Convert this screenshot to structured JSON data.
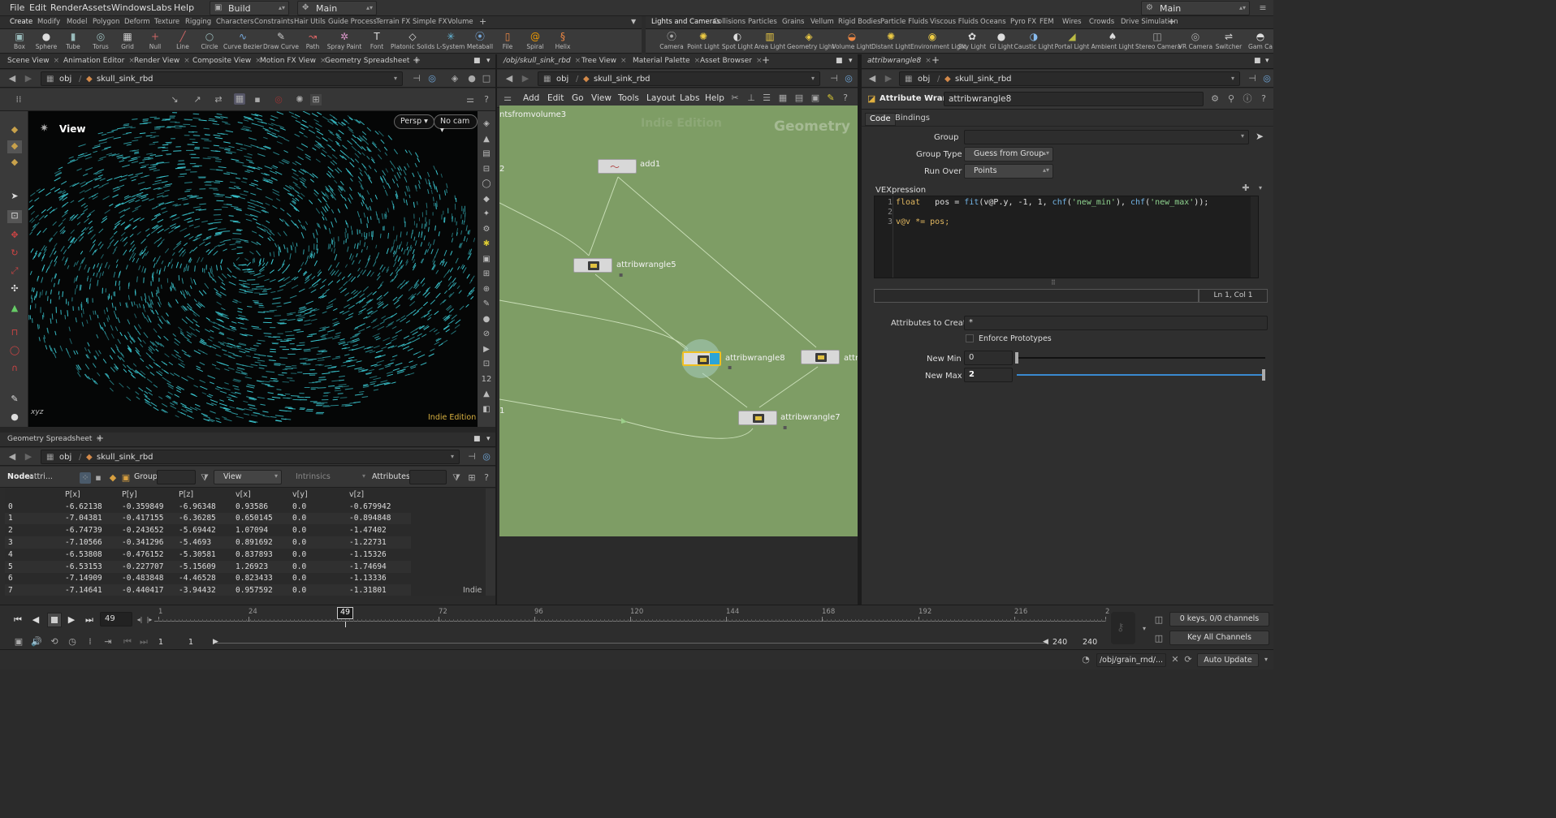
{
  "menubar": {
    "items": [
      "File",
      "Edit",
      "Render",
      "Assets",
      "Windows",
      "Labs",
      "Help"
    ],
    "desktop": "Build",
    "context": "Main",
    "right_desktop": "Main"
  },
  "shelf_tabs_left": [
    "Create",
    "Modify",
    "Model",
    "Polygon",
    "Deform",
    "Texture",
    "Rigging",
    "Characters",
    "Constraints",
    "Hair Utils",
    "Guide Process",
    "Terrain FX",
    "Simple FX",
    "Volume"
  ],
  "shelf_tabs_right": [
    "Lights and Cameras",
    "Collisions",
    "Particles",
    "Grains",
    "Vellum",
    "Rigid Bodies",
    "Particle Fluids",
    "Viscous Fluids",
    "Oceans",
    "Pyro FX",
    "FEM",
    "Wires",
    "Crowds",
    "Drive Simulation"
  ],
  "tools_left": [
    {
      "label": "Box",
      "icon": "cube-icon"
    },
    {
      "label": "Sphere",
      "icon": "sphere-icon"
    },
    {
      "label": "Tube",
      "icon": "tube-icon"
    },
    {
      "label": "Torus",
      "icon": "torus-icon"
    },
    {
      "label": "Grid",
      "icon": "grid-icon"
    },
    {
      "label": "Null",
      "icon": "null-icon"
    },
    {
      "label": "Line",
      "icon": "line-icon"
    },
    {
      "label": "Circle",
      "icon": "circle-icon"
    },
    {
      "label": "Curve Bezier",
      "icon": "curve-icon"
    },
    {
      "label": "Draw Curve",
      "icon": "draw-curve-icon"
    },
    {
      "label": "Path",
      "icon": "path-icon"
    },
    {
      "label": "Spray Paint",
      "icon": "spray-icon"
    },
    {
      "label": "Font",
      "icon": "font-icon"
    },
    {
      "label": "Platonic Solids",
      "icon": "platonic-icon"
    },
    {
      "label": "L-System",
      "icon": "lsystem-icon"
    },
    {
      "label": "Metaball",
      "icon": "metaball-icon"
    },
    {
      "label": "File",
      "icon": "file-icon"
    },
    {
      "label": "Spiral",
      "icon": "spiral-icon"
    },
    {
      "label": "Helix",
      "icon": "helix-icon"
    }
  ],
  "tools_right": [
    {
      "label": "Camera"
    },
    {
      "label": "Point Light"
    },
    {
      "label": "Spot Light"
    },
    {
      "label": "Area Light"
    },
    {
      "label": "Geometry Light"
    },
    {
      "label": "Volume Light"
    },
    {
      "label": "Distant Light"
    },
    {
      "label": "Environment Light"
    },
    {
      "label": "Sky Light"
    },
    {
      "label": "GI Light"
    },
    {
      "label": "Caustic Light"
    },
    {
      "label": "Portal Light"
    },
    {
      "label": "Ambient Light"
    },
    {
      "label": "Stereo Camera"
    },
    {
      "label": "VR Camera"
    },
    {
      "label": "Switcher"
    },
    {
      "label": "Gam Ca"
    }
  ],
  "left_pane": {
    "tabs": [
      "Scene View",
      "Animation Editor",
      "Render View",
      "Composite View",
      "Motion FX View",
      "Geometry Spreadsheet"
    ],
    "path_obj": "obj",
    "path_node": "skull_sink_rbd",
    "viewport": {
      "title": "View",
      "persp": "Persp",
      "cam": "No cam",
      "edition": "Indie Edition",
      "axes": "xyz"
    }
  },
  "spreadsheet": {
    "tab": "Geometry Spreadsheet",
    "path_obj": "obj",
    "path_node": "skull_sink_rbd",
    "node_label": "Node:",
    "node_value": "attri...",
    "group_label": "Group:",
    "view_label": "View",
    "intrinsics_label": "Intrinsics",
    "attributes_label": "Attributes:",
    "indie": "Indie",
    "columns": [
      "",
      "P[x]",
      "P[y]",
      "P[z]",
      "v[x]",
      "v[y]",
      "v[z]"
    ],
    "rows": [
      [
        "0",
        "-6.62138",
        "-0.359849",
        "-6.96348",
        "0.93586",
        "0.0",
        "-0.679942"
      ],
      [
        "1",
        "-7.04381",
        "-0.417155",
        "-6.36285",
        "0.650145",
        "0.0",
        "-0.894848"
      ],
      [
        "2",
        "-6.74739",
        "-0.243652",
        "-5.69442",
        "1.07094",
        "0.0",
        "-1.47402"
      ],
      [
        "3",
        "-7.10566",
        "-0.341296",
        "-5.4693",
        "0.891692",
        "0.0",
        "-1.22731"
      ],
      [
        "4",
        "-6.53808",
        "-0.476152",
        "-5.30581",
        "0.837893",
        "0.0",
        "-1.15326"
      ],
      [
        "5",
        "-6.53153",
        "-0.227707",
        "-5.15609",
        "1.26923",
        "0.0",
        "-1.74694"
      ],
      [
        "6",
        "-7.14909",
        "-0.483848",
        "-4.46528",
        "0.823433",
        "0.0",
        "-1.13336"
      ],
      [
        "7",
        "-7.14641",
        "-0.440417",
        "-3.94432",
        "0.957592",
        "0.0",
        "-1.31801"
      ]
    ]
  },
  "network": {
    "tabs": [
      "/obj/skull_sink_rbd",
      "Tree View",
      "Material Palette",
      "Asset Browser"
    ],
    "path_obj": "obj",
    "path_node": "skull_sink_rbd",
    "menu": [
      "Add",
      "Edit",
      "Go",
      "View",
      "Tools",
      "Layout",
      "Labs",
      "Help"
    ],
    "context_label": "Geometry",
    "watermark": "Indie Edition",
    "partial_left": "ntsfromvolume3",
    "edge_label_a": "2",
    "edge_label_b": "1",
    "nodes": [
      {
        "name": "add1"
      },
      {
        "name": "attribwrangle5"
      },
      {
        "name": "attribwrangle8"
      },
      {
        "name": "attr"
      },
      {
        "name": "attribwrangle7"
      }
    ]
  },
  "params": {
    "tab": "attribwrangle8",
    "path_obj": "obj",
    "path_node": "skull_sink_rbd",
    "node_type": "Attribute Wrangle",
    "node_name": "attribwrangle8",
    "subtabs": [
      "Code",
      "Bindings"
    ],
    "group_label": "Group",
    "group_value": "",
    "group_type_label": "Group Type",
    "group_type_value": "Guess from Group",
    "run_over_label": "Run Over",
    "run_over_value": "Points",
    "vex_label": "VEXpression",
    "code_lines": [
      {
        "num": "1"
      },
      {
        "num": "2"
      },
      {
        "num": "3"
      }
    ],
    "code_text": {
      "l1_kw": "float",
      "l1_a": "   pos = ",
      "l1_fn1": "fit",
      "l1_b": "(v@P.y, -1, 1, ",
      "l1_fn2": "chf",
      "l1_c": "(",
      "l1_s1": "'new_min'",
      "l1_d": "), ",
      "l1_fn3": "chf",
      "l1_e": "(",
      "l1_s2": "'new_max'",
      "l1_f": "));",
      "l3": "v@v *= pos;"
    },
    "cursor": "Ln 1, Col 1",
    "attributes_label": "Attributes to Create",
    "attributes_value": "*",
    "enforce_label": "Enforce Prototypes",
    "new_min_label": "New Min",
    "new_min_value": "0",
    "new_max_label": "New Max",
    "new_max_value": "2",
    "slider_range": [
      0,
      2
    ]
  },
  "timeline": {
    "current_frame": "49",
    "marker": "49",
    "ticks": [
      "1",
      "24",
      "48",
      "72",
      "96",
      "120",
      "144",
      "168",
      "192",
      "216",
      "2"
    ],
    "range_start": "1",
    "range_start2": "1",
    "range_end": "240",
    "range_end2": "240",
    "keys": "0 keys, 0/0 channels",
    "key_all": "Key All Channels"
  },
  "status": {
    "path": "/obj/grain_rnd/...",
    "update": "Auto Update"
  }
}
